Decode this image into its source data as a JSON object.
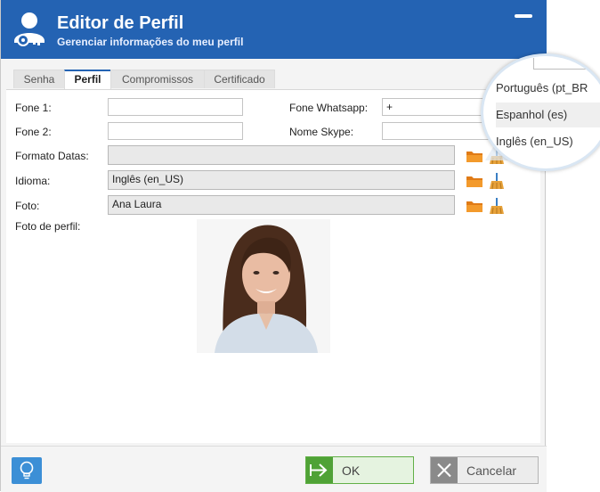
{
  "header": {
    "title": "Editor de Perfil",
    "subtitle": "Gerenciar informações do meu perfil",
    "accent_color": "#2463b3",
    "logo_icon": "user-key-icon"
  },
  "tabs": [
    {
      "label": "Senha",
      "active": false
    },
    {
      "label": "Perfil",
      "active": true
    },
    {
      "label": "Compromissos",
      "active": false
    },
    {
      "label": "Certificado",
      "active": false
    }
  ],
  "form": {
    "fone1": {
      "label": "Fone 1:",
      "value": ""
    },
    "fone2": {
      "label": "Fone 2:",
      "value": ""
    },
    "whatsapp": {
      "label": "Fone Whatsapp:",
      "value": "+"
    },
    "skype": {
      "label": "Nome Skype:",
      "value": ""
    },
    "formato_datas": {
      "label": "Formato Datas:",
      "value": ""
    },
    "idioma": {
      "label": "Idioma:",
      "value": "Inglês (en_US)"
    },
    "foto": {
      "label": "Foto:",
      "value": "Ana Laura"
    },
    "foto_perfil": {
      "label": "Foto de perfil:"
    }
  },
  "language_menu": {
    "items": [
      "Português (pt_BR",
      "Espanhol (es)",
      "Inglês (en_US)"
    ],
    "highlighted_index": 1
  },
  "footer": {
    "ok_label": "OK",
    "cancel_label": "Cancelar",
    "ok_color": "#4fa236",
    "cancel_color": "#8a8a8a"
  }
}
